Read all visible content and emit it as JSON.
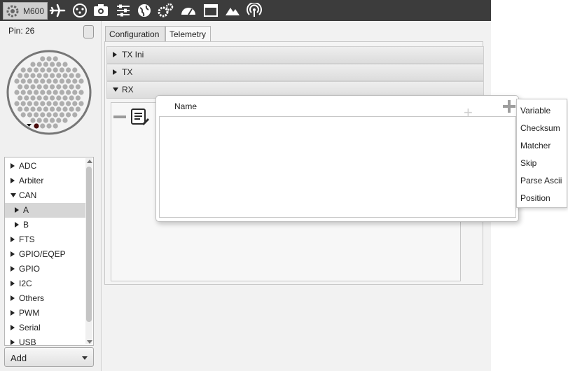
{
  "toolbar": {
    "device_label": "M600",
    "icons": [
      "gear-icon",
      "airplane-icon",
      "controller-icon",
      "camera-icon",
      "sliders-icon",
      "globe-icon",
      "cogs-icon",
      "gauge-icon",
      "window-icon",
      "mountain-icon",
      "signal-icon"
    ]
  },
  "left_panel": {
    "pin_label": "Pin: 26",
    "tree": [
      {
        "label": "ADC",
        "expanded": false,
        "depth": 0
      },
      {
        "label": "Arbiter",
        "expanded": false,
        "depth": 0
      },
      {
        "label": "CAN",
        "expanded": true,
        "depth": 0
      },
      {
        "label": "A",
        "expanded": false,
        "depth": 1,
        "selected": true
      },
      {
        "label": "B",
        "expanded": false,
        "depth": 1
      },
      {
        "label": "FTS",
        "expanded": false,
        "depth": 0
      },
      {
        "label": "GPIO/EQEP",
        "expanded": false,
        "depth": 0
      },
      {
        "label": "GPIO",
        "expanded": false,
        "depth": 0
      },
      {
        "label": "I2C",
        "expanded": false,
        "depth": 0
      },
      {
        "label": "Others",
        "expanded": false,
        "depth": 0
      },
      {
        "label": "PWM",
        "expanded": false,
        "depth": 0
      },
      {
        "label": "Serial",
        "expanded": false,
        "depth": 0
      },
      {
        "label": "USB",
        "expanded": false,
        "depth": 0
      }
    ],
    "add_button": "Add"
  },
  "tabs": [
    {
      "label": "Configuration",
      "active": false
    },
    {
      "label": "Telemetry",
      "active": true
    }
  ],
  "sections": [
    {
      "label": "TX Ini",
      "expanded": false
    },
    {
      "label": "TX",
      "expanded": false
    },
    {
      "label": "RX",
      "expanded": true
    }
  ],
  "popup": {
    "column_header": "Name"
  },
  "menu": {
    "items": [
      "Variable",
      "Checksum",
      "Matcher",
      "Skip",
      "Parse Ascii",
      "Position"
    ]
  },
  "colors": {
    "toolbar_bg": "#3c3c3c",
    "panel_bg": "#f0f0f0",
    "selected_row": "#d6d6d6"
  }
}
